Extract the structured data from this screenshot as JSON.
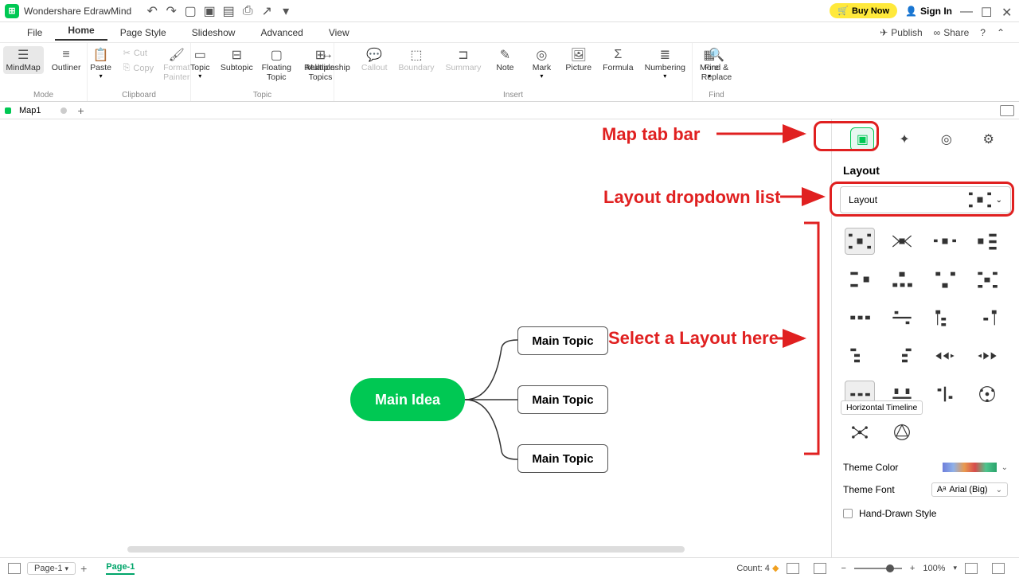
{
  "app": {
    "title": "Wondershare EdrawMind"
  },
  "titlebar": {
    "buy": "Buy Now",
    "signin": "Sign In"
  },
  "menus": {
    "file": "File",
    "home": "Home",
    "page_style": "Page Style",
    "slideshow": "Slideshow",
    "advanced": "Advanced",
    "view": "View",
    "publish": "Publish",
    "share": "Share"
  },
  "ribbon": {
    "groups": {
      "mode": "Mode",
      "clipboard": "Clipboard",
      "topic": "Topic",
      "insert": "Insert",
      "find": "Find"
    },
    "mindmap": "MindMap",
    "outliner": "Outliner",
    "paste": "Paste",
    "cut": "Cut",
    "copy": "Copy",
    "format_painter": "Format\nPainter",
    "topic": "Topic",
    "subtopic": "Subtopic",
    "floating": "Floating\nTopic",
    "multiple": "Multiple\nTopics",
    "relationship": "Relationship",
    "callout": "Callout",
    "boundary": "Boundary",
    "summary": "Summary",
    "note": "Note",
    "mark": "Mark",
    "picture": "Picture",
    "formula": "Formula",
    "numbering": "Numbering",
    "more": "More",
    "find_replace": "Find &\nReplace"
  },
  "tab": {
    "name": "Map1"
  },
  "mind": {
    "main": "Main Idea",
    "t1": "Main Topic",
    "t2": "Main Topic",
    "t3": "Main Topic"
  },
  "ann": {
    "tab_bar": "Map tab bar",
    "dropdown": "Layout dropdown list",
    "select": "Select a Layout here"
  },
  "panel": {
    "title": "Layout",
    "dd_label": "Layout",
    "tooltip": "Horizontal Timeline",
    "theme_color": "Theme Color",
    "theme_font": "Theme Font",
    "font_value": "Arial (Big)",
    "hand_drawn": "Hand-Drawn Style"
  },
  "status": {
    "page_sel": "Page-1",
    "page_tab": "Page-1",
    "count": "Count: 4",
    "zoom": "100%"
  }
}
